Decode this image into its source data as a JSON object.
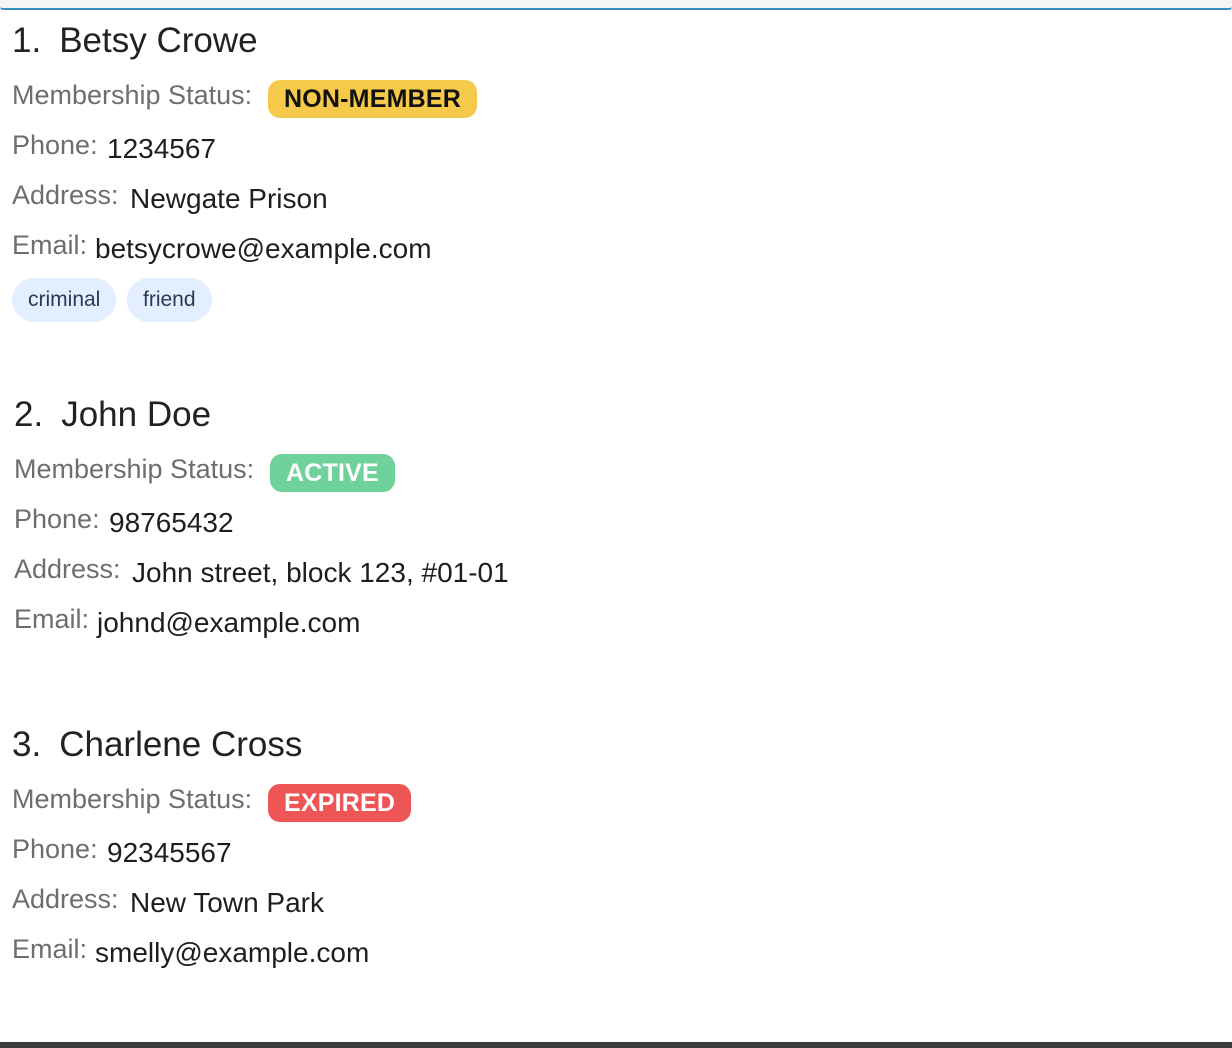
{
  "labels": {
    "membership": "Membership Status:",
    "phone": "Phone:",
    "address": "Address:",
    "email": "Email:"
  },
  "persons": [
    {
      "index": "1.",
      "name": "Betsy Crowe",
      "status": "NON-MEMBER",
      "status_color": "#f5c94a",
      "phone": "1234567",
      "address": "Newgate Prison",
      "email": "betsycrowe@example.com",
      "tags": [
        "criminal",
        "friend"
      ]
    },
    {
      "index": "2.",
      "name": "John Doe",
      "status": "ACTIVE",
      "status_color": "#6fd29b",
      "phone": "98765432",
      "address": "John street, block 123, #01-01",
      "email": "johnd@example.com",
      "tags": []
    },
    {
      "index": "3.",
      "name": "Charlene Cross",
      "status": "EXPIRED",
      "status_color": "#ee5656",
      "phone": "92345567",
      "address": "New Town Park",
      "email": "smelly@example.com",
      "tags": []
    }
  ]
}
